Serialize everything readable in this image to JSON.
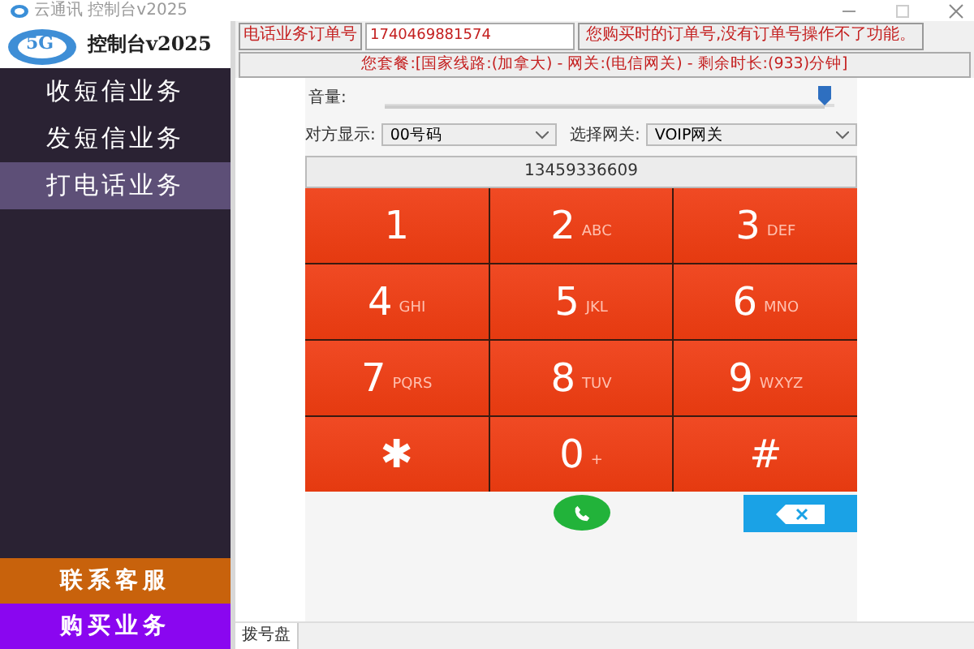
{
  "window": {
    "title": "云通讯 控制台v2025"
  },
  "sidebar": {
    "logo_badge": "5G",
    "logo_text": "控制台v2025",
    "items": [
      {
        "label": "收短信业务",
        "selected": false
      },
      {
        "label": "发短信业务",
        "selected": false
      },
      {
        "label": "打电话业务",
        "selected": true
      }
    ],
    "bottom_items": [
      {
        "label": "联系客服",
        "color": "#c8620c"
      },
      {
        "label": "购买业务",
        "color": "#8a06f0"
      }
    ]
  },
  "order": {
    "label": "电话业务订单号",
    "value": "1740469881574",
    "note": "您购买时的订单号,没有订单号操作不了功能。"
  },
  "package_info": "您套餐:[国家线路:(加拿大) - 网关:(电信网关) - 剩余时长:(933)分钟]",
  "volume": {
    "label": "音量:",
    "level": 0.98
  },
  "caller_display": {
    "label": "对方显示:",
    "value": "00号码"
  },
  "gateway": {
    "label": "选择网关:",
    "value": "VOIP网关"
  },
  "number_display": "13459336609",
  "keypad": [
    {
      "digit": "1"
    },
    {
      "digit": "2",
      "letters": "ABC"
    },
    {
      "digit": "3",
      "letters": "DEF"
    },
    {
      "digit": "4",
      "letters": "GHI"
    },
    {
      "digit": "5",
      "letters": "JKL"
    },
    {
      "digit": "6",
      "letters": "MNO"
    },
    {
      "digit": "7",
      "letters": "PQRS"
    },
    {
      "digit": "8",
      "letters": "TUV"
    },
    {
      "digit": "9",
      "letters": "WXYZ"
    },
    {
      "digit": "✱"
    },
    {
      "digit": "0",
      "letters": "+"
    },
    {
      "digit": "#"
    }
  ],
  "bottom_tab": {
    "label": "拨号盘",
    "selected": true
  }
}
